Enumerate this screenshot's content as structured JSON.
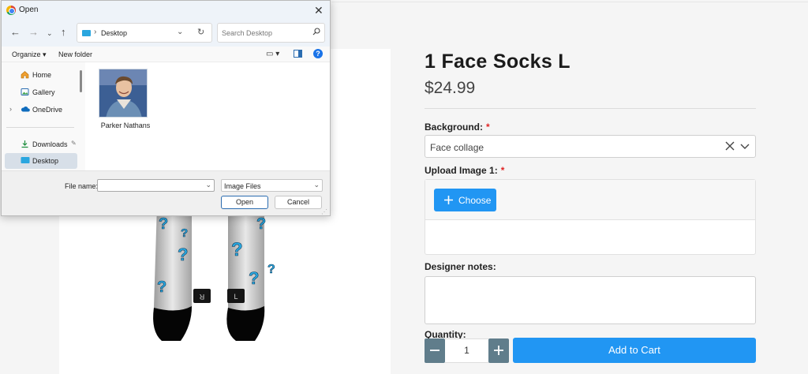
{
  "product": {
    "title": "1 Face Socks L",
    "price": "$24.99",
    "background_label": "Background:",
    "required_mark": "*",
    "background_value": "Face collage",
    "upload_label": "Upload Image 1:",
    "choose_label": "Choose",
    "notes_label": "Designer notes:",
    "quantity_label": "Quantity:",
    "quantity_value": "1",
    "add_to_cart": "Add to Cart",
    "sock_tags": [
      "R",
      "L"
    ]
  },
  "dialog": {
    "title": "Open",
    "close_glyph": "✕",
    "path": "Desktop",
    "search_placeholder": "Search Desktop",
    "organize": "Organize ▾",
    "new_folder": "New folder",
    "nav_items": [
      {
        "label": "Home",
        "icon": "home-icon"
      },
      {
        "label": "Gallery",
        "icon": "gallery-icon"
      },
      {
        "label": "OneDrive",
        "icon": "cloud-icon"
      },
      {
        "label": "Downloads",
        "icon": "download-icon"
      },
      {
        "label": "Desktop",
        "icon": "desktop-folder-icon"
      }
    ],
    "files": [
      {
        "name": "Parker Nathans"
      }
    ],
    "file_name_label": "File name:",
    "file_name_value": "",
    "file_type": "Image Files",
    "open_button": "Open",
    "cancel_button": "Cancel"
  },
  "colors": {
    "accent": "#2196f3",
    "qty_button": "#607d8b",
    "required": "#e02424",
    "sock_pattern": "#29a8e0"
  }
}
